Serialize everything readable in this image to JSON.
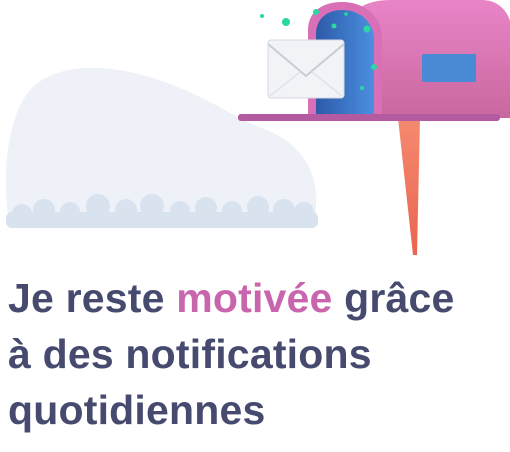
{
  "headline": {
    "line1_before": "Je reste ",
    "line1_highlight": "motivée",
    "line1_after": " grâce",
    "line2": "à des notifications",
    "line3": "quotidiennes"
  },
  "colors": {
    "text": "#454a6e",
    "accent": "#c965ad",
    "mailbox": "#e07ec0",
    "mailbox_interior": "#3b6fc4",
    "flag": "#4a8ad4",
    "post": "#f07a62",
    "cloud": "#edf1f7",
    "sparkles": "#2ad9a0"
  },
  "icons": {
    "envelope": "envelope-icon",
    "mailbox": "mailbox-icon",
    "cloud": "cloud-icon"
  }
}
